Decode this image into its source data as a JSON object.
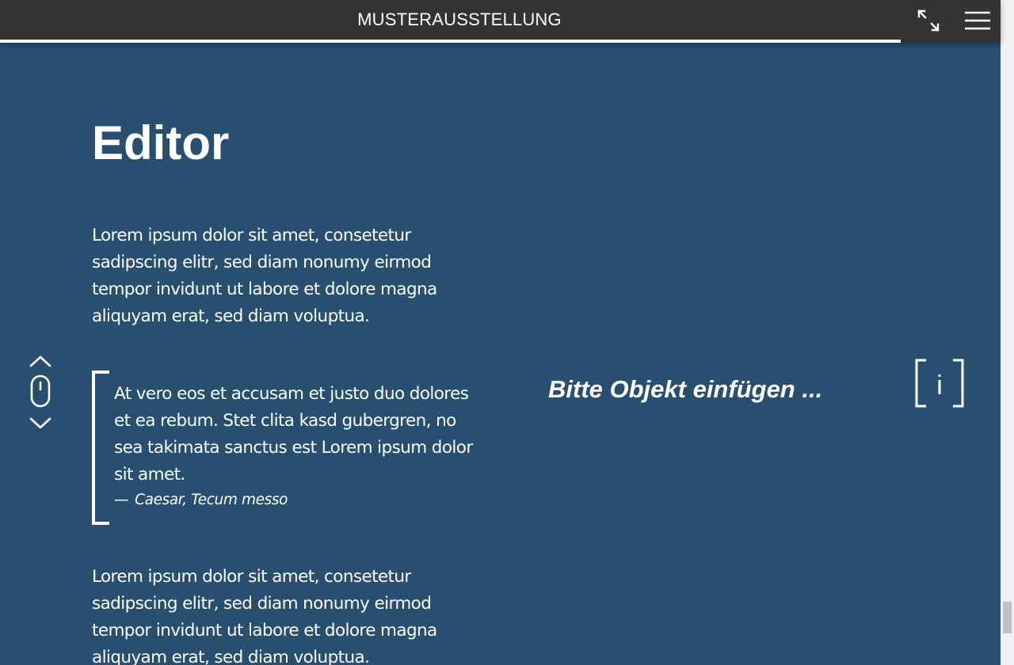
{
  "header": {
    "title": "MUSTERAUSSTELLUNG",
    "progress_percent": 90
  },
  "main": {
    "title": "Editor",
    "paragraph_1": "Lorem ipsum dolor sit amet, consetetur sadipscing elitr, sed diam nonumy eirmod tempor invidunt ut labore et dolore magna aliquyam erat, sed diam voluptua.",
    "quote": {
      "text": "At vero eos et accusam et justo duo dolores et ea rebum. Stet clita kasd gubergren, no sea takimata sanctus est Lorem ipsum dolor sit amet.",
      "dash": "—",
      "attribution": "Caesar, Tecum messo"
    },
    "paragraph_2": "Lorem ipsum dolor sit amet, consetetur sadipscing elitr, sed diam nonumy eirmod tempor invidunt ut labore et dolore magna aliquyam erat, sed diam voluptua."
  },
  "object_placeholder": "Bitte Objekt einfügen ...",
  "info_button": {
    "letter": "i",
    "icon": "info-icon"
  },
  "icons": {
    "fullscreen": "fullscreen-icon",
    "menu": "hamburger-menu-icon",
    "scroll": "mouse-scroll-icon"
  },
  "scroll": {
    "thumb_position_fraction": 0.95
  },
  "colors": {
    "background": "#284f70",
    "header": "#333333",
    "text": "#ffffff"
  }
}
